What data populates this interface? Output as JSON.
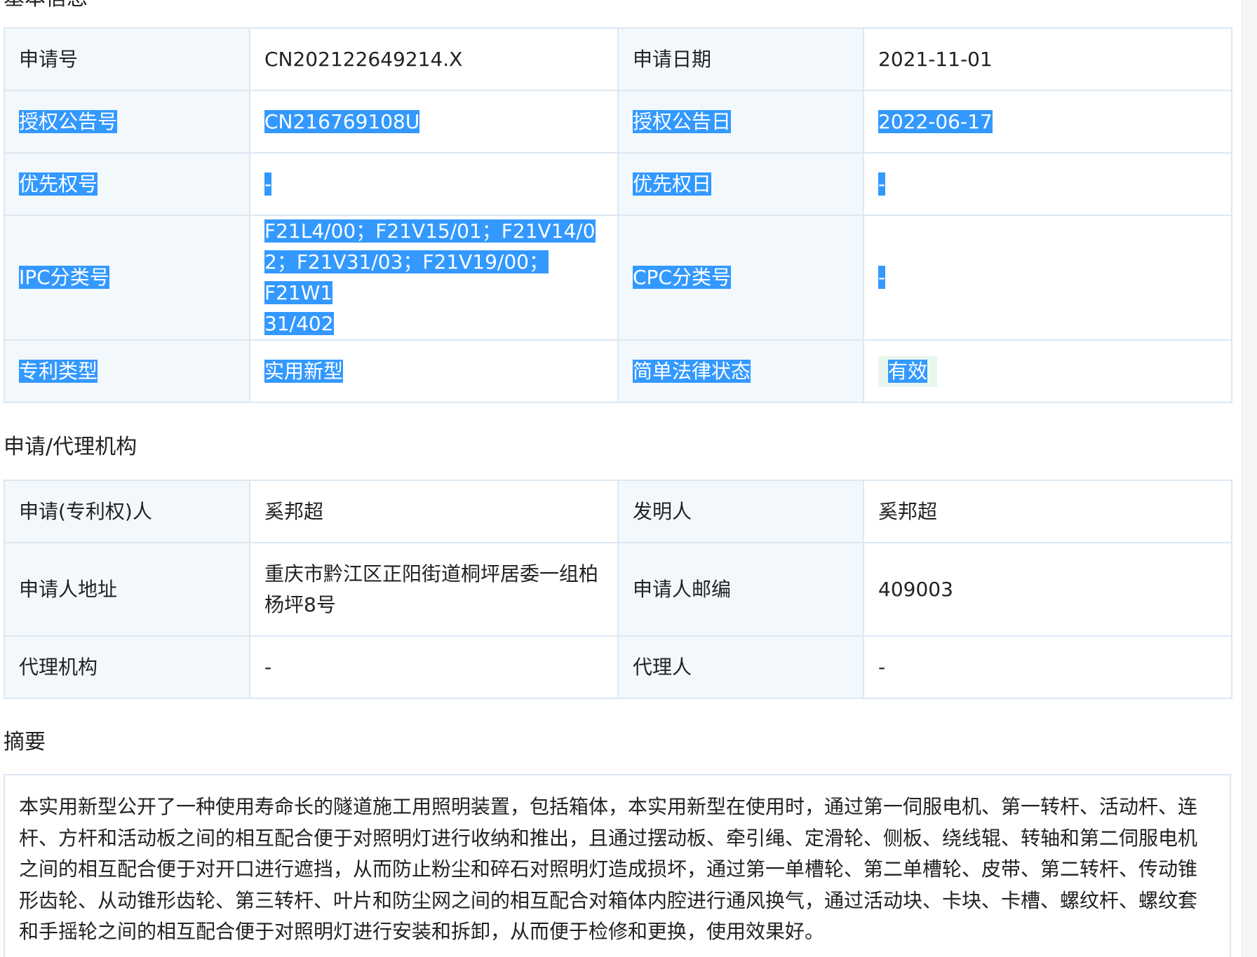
{
  "sections": {
    "basic_title": "基本信息",
    "agency_title": "申请/代理机构",
    "abstract_title": "摘要"
  },
  "basic": {
    "app_no_label": "申请号",
    "app_no": "CN202122649214.X",
    "app_date_label": "申请日期",
    "app_date": "2021-11-01",
    "grant_no_label": "授权公告号",
    "grant_no": "CN216769108U",
    "grant_date_label": "授权公告日",
    "grant_date": "2022-06-17",
    "priority_no_label": "优先权号",
    "priority_no": "-",
    "priority_date_label": "优先权日",
    "priority_date": "-",
    "ipc_label": "IPC分类号",
    "ipc_lines": [
      "F21L4/00；F21V15/01；F21V14/0",
      "2；F21V31/03；F21V19/00；F21W1",
      "31/402"
    ],
    "cpc_label": "CPC分类号",
    "cpc": "-",
    "type_label": "专利类型",
    "type": "实用新型",
    "legal_status_label": "简单法律状态",
    "legal_status": "有效"
  },
  "agency": {
    "applicant_label": "申请(专利权)人",
    "applicant": "奚邦超",
    "inventor_label": "发明人",
    "inventor": "奚邦超",
    "address_label": "申请人地址",
    "address_lines": [
      "重庆市黔江区正阳街道桐坪居委一组柏",
      "杨坪8号"
    ],
    "postcode_label": "申请人邮编",
    "postcode": "409003",
    "agency_label": "代理机构",
    "agency": "-",
    "agent_label": "代理人",
    "agent": "-"
  },
  "abstract": {
    "lines": [
      "本实用新型公开了一种使用寿命长的隧道施工用照明装置，包括箱体，本实用新型在使用时，通过第一伺服电机、第一转杆、活动杆、连",
      "杆、方杆和活动板之间的相互配合便于对照明灯进行收纳和推出，且通过摆动板、牵引绳、定滑轮、侧板、绕线辊、转轴和第二伺服电机",
      "之间的相互配合便于对开口进行遮挡，从而防止粉尘和碎石对照明灯造成损坏，通过第一单槽轮、第二单槽轮、皮带、第二转杆、传动锥",
      "形齿轮、从动锥形齿轮、第三转杆、叶片和防尘网之间的相互配合对箱体内腔进行通风换气，通过活动块、卡块、卡槽、螺纹杆、螺纹套",
      "和手摇轮之间的相互配合便于对照明灯进行安装和拆卸，从而便于检修和更换，使用效果好。"
    ]
  },
  "colors": {
    "selection": "#3399ff",
    "key_cell_bg": "#f3f8fc",
    "border": "#dde8f2",
    "status_badge_bg": "#e8f7ee"
  }
}
